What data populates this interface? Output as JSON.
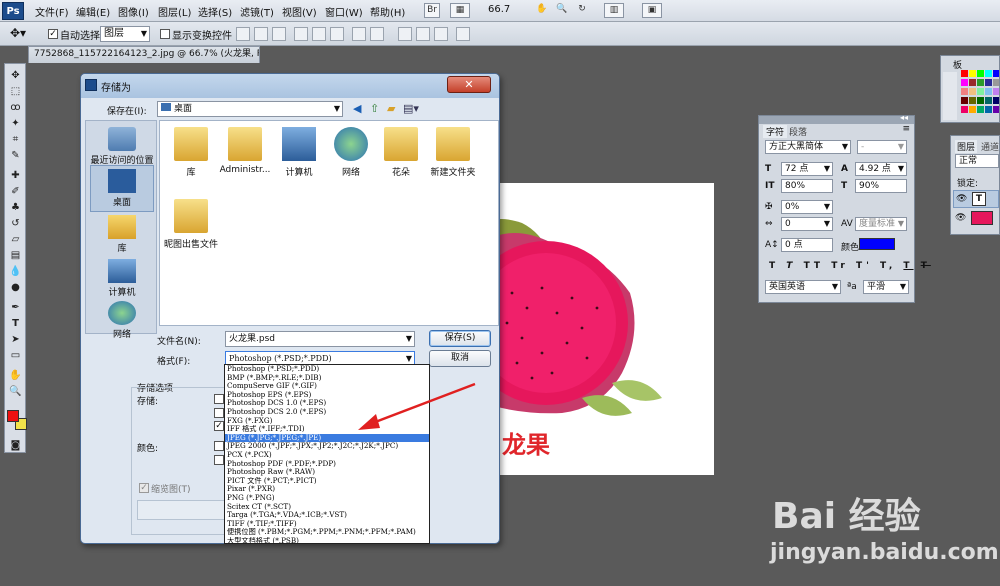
{
  "app": {
    "logo": "Ps"
  },
  "menu": [
    "文件(F)",
    "编辑(E)",
    "图像(I)",
    "图层(L)",
    "选择(S)",
    "滤镜(T)",
    "视图(V)",
    "窗口(W)",
    "帮助(H)"
  ],
  "toolbar_top": {
    "zoom": "66.7"
  },
  "options_bar": {
    "auto_select_label": "自动选择:",
    "layer_select": "图层",
    "show_transform_label": "显示变换控件"
  },
  "document_tab": "7752868_115722164123_2.jpg @ 66.7% (火龙果, RGB/8) *",
  "save_dialog": {
    "title": "存储为",
    "save_in_label": "保存在(I):",
    "save_in_value": "桌面",
    "sidebar": [
      "最近访问的位置",
      "桌面",
      "库",
      "计算机",
      "网络"
    ],
    "files": [
      "库",
      "Administr...",
      "计算机",
      "网络",
      "花朵",
      "新建文件夹",
      "昵图出售文件"
    ],
    "filename_label": "文件名(N):",
    "filename_value": "火龙果.psd",
    "format_label": "格式(F):",
    "format_value": "Photoshop (*.PSD;*.PDD)",
    "save_button": "保存(S)",
    "cancel_button": "取消",
    "options_title": "存储选项",
    "storage_label": "存储:",
    "color_label": "颜色:",
    "thumbnail_label": "缩览图(T)",
    "format_options": [
      "Photoshop (*.PSD;*.PDD)",
      "BMP (*.BMP;*.RLE;*.DIB)",
      "CompuServe GIF (*.GIF)",
      "Photoshop EPS (*.EPS)",
      "Photoshop DCS 1.0 (*.EPS)",
      "Photoshop DCS 2.0 (*.EPS)",
      "FXG (*.FXG)",
      "IFF 格式 (*.IFF;*.TDI)",
      "JPEG (*.JPG;*.JPEG;*.JPE)",
      "JPEG 2000 (*.JPF;*.JPX;*.JP2;*.J2C;*.J2K;*.JPC)",
      "PCX (*.PCX)",
      "Photoshop PDF (*.PDF;*.PDP)",
      "Photoshop Raw (*.RAW)",
      "PICT 文件 (*.PCT;*.PICT)",
      "Pixar (*.PXR)",
      "PNG (*.PNG)",
      "Scitex CT (*.SCT)",
      "Targa (*.TGA;*.VDA;*.ICB;*.VST)",
      "TIFF (*.TIF;*.TIFF)",
      "便携位图 (*.PBM;*.PGM;*.PPM;*.PNM;*.PFM;*.PAM)",
      "大型文档格式 (*.PSB)"
    ],
    "selected_format_index": 8
  },
  "canvas_text": "龙果",
  "character_panel": {
    "tabs": [
      "字符",
      "段落"
    ],
    "font_family": "方正大黑简体",
    "font_style": "-",
    "font_size": "72 点",
    "leading": "4.92 点",
    "vertical_scale": "80%",
    "horizontal_scale": "90%",
    "tracking_pct": "0%",
    "kerning": "0",
    "kerning_mode": "度量标准",
    "baseline": "0 点",
    "color_label": "颜色:",
    "color": "#0000ff",
    "style_buttons": [
      "T",
      "T",
      "TT",
      "Tr",
      "T'",
      "T,",
      "T",
      "T"
    ],
    "language": "英国英语",
    "aa_label": "a",
    "antialias": "平滑"
  },
  "layers_panel": {
    "tabs": [
      "图层",
      "通道"
    ],
    "blend": "正常",
    "lock_label": "锁定:"
  },
  "swatches_tab": "板",
  "watermark": {
    "logo": "Bai 经验",
    "url": "jingyan.baidu.com"
  },
  "colors": {
    "foreground": "#ee1111",
    "background": "#f3e34a",
    "selection": "#3a7be0",
    "accent_red": "#e0262b"
  }
}
